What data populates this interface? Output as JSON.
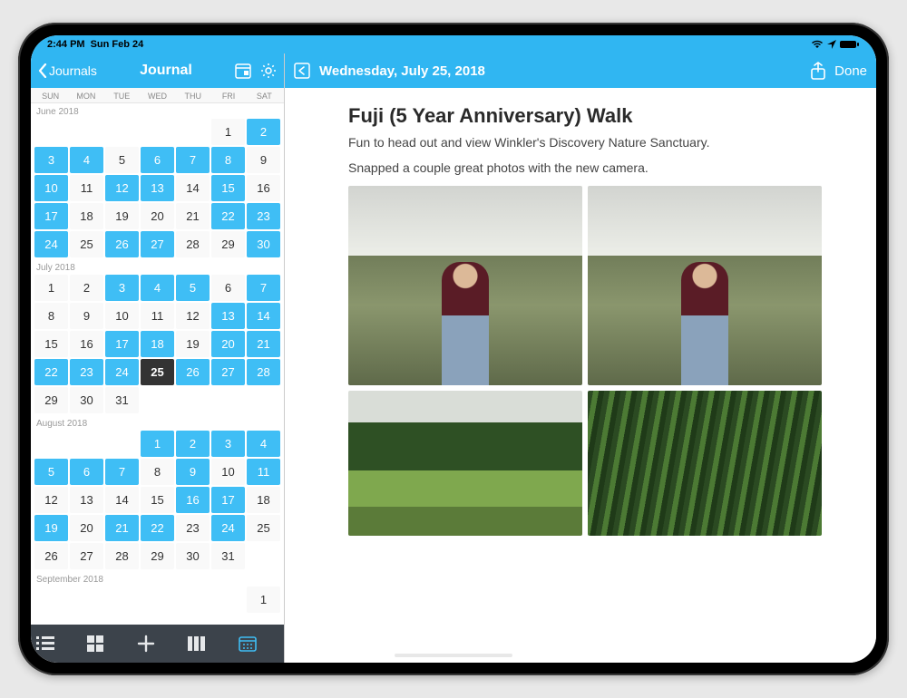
{
  "status": {
    "time": "2:44 PM",
    "date": "Sun Feb 24"
  },
  "left_nav": {
    "back_label": "Journals",
    "title": "Journal"
  },
  "weekdays": [
    "SUN",
    "MON",
    "TUE",
    "WED",
    "THU",
    "FRI",
    "SAT"
  ],
  "months": [
    {
      "label": "June 2018",
      "offset": 5,
      "days": [
        {
          "n": 1
        },
        {
          "n": 2,
          "e": 1
        },
        {
          "n": 3,
          "e": 1
        },
        {
          "n": 4,
          "e": 1
        },
        {
          "n": 5
        },
        {
          "n": 6,
          "e": 1
        },
        {
          "n": 7,
          "e": 1
        },
        {
          "n": 8,
          "e": 1
        },
        {
          "n": 9
        },
        {
          "n": 10,
          "e": 1
        },
        {
          "n": 11
        },
        {
          "n": 12,
          "e": 1
        },
        {
          "n": 13,
          "e": 1
        },
        {
          "n": 14
        },
        {
          "n": 15,
          "e": 1
        },
        {
          "n": 16
        },
        {
          "n": 17,
          "e": 1
        },
        {
          "n": 18
        },
        {
          "n": 19
        },
        {
          "n": 20
        },
        {
          "n": 21
        },
        {
          "n": 22,
          "e": 1
        },
        {
          "n": 23,
          "e": 1
        },
        {
          "n": 24,
          "e": 1
        },
        {
          "n": 25
        },
        {
          "n": 26,
          "e": 1
        },
        {
          "n": 27,
          "e": 1
        },
        {
          "n": 28
        },
        {
          "n": 29
        },
        {
          "n": 30,
          "e": 1
        }
      ]
    },
    {
      "label": "July 2018",
      "offset": 0,
      "days": [
        {
          "n": 1
        },
        {
          "n": 2
        },
        {
          "n": 3,
          "e": 1
        },
        {
          "n": 4,
          "e": 1
        },
        {
          "n": 5,
          "e": 1
        },
        {
          "n": 6
        },
        {
          "n": 7,
          "e": 1
        },
        {
          "n": 8
        },
        {
          "n": 9
        },
        {
          "n": 10
        },
        {
          "n": 11
        },
        {
          "n": 12
        },
        {
          "n": 13,
          "e": 1
        },
        {
          "n": 14,
          "e": 1
        },
        {
          "n": 15
        },
        {
          "n": 16
        },
        {
          "n": 17,
          "e": 1
        },
        {
          "n": 18,
          "e": 1
        },
        {
          "n": 19
        },
        {
          "n": 20,
          "e": 1
        },
        {
          "n": 21,
          "e": 1
        },
        {
          "n": 22,
          "e": 1
        },
        {
          "n": 23,
          "e": 1
        },
        {
          "n": 24,
          "e": 1
        },
        {
          "n": 25,
          "sel": 1
        },
        {
          "n": 26,
          "e": 1
        },
        {
          "n": 27,
          "e": 1
        },
        {
          "n": 28,
          "e": 1
        },
        {
          "n": 29
        },
        {
          "n": 30
        },
        {
          "n": 31
        }
      ]
    },
    {
      "label": "August 2018",
      "offset": 3,
      "days": [
        {
          "n": 1,
          "e": 1
        },
        {
          "n": 2,
          "e": 1
        },
        {
          "n": 3,
          "e": 1
        },
        {
          "n": 4,
          "e": 1
        },
        {
          "n": 5,
          "e": 1
        },
        {
          "n": 6,
          "e": 1
        },
        {
          "n": 7,
          "e": 1
        },
        {
          "n": 8
        },
        {
          "n": 9,
          "e": 1
        },
        {
          "n": 10
        },
        {
          "n": 11,
          "e": 1
        },
        {
          "n": 12
        },
        {
          "n": 13
        },
        {
          "n": 14
        },
        {
          "n": 15
        },
        {
          "n": 16,
          "e": 1
        },
        {
          "n": 17,
          "e": 1
        },
        {
          "n": 18
        },
        {
          "n": 19,
          "e": 1
        },
        {
          "n": 20
        },
        {
          "n": 21,
          "e": 1
        },
        {
          "n": 22,
          "e": 1
        },
        {
          "n": 23
        },
        {
          "n": 24,
          "e": 1
        },
        {
          "n": 25
        },
        {
          "n": 26
        },
        {
          "n": 27
        },
        {
          "n": 28
        },
        {
          "n": 29
        },
        {
          "n": 30
        },
        {
          "n": 31
        }
      ]
    },
    {
      "label": "September 2018",
      "offset": 6,
      "days": [
        {
          "n": 1
        }
      ]
    }
  ],
  "entry": {
    "date_label": "Wednesday, July 25, 2018",
    "done_label": "Done",
    "title": "Fuji (5 Year Anniversary) Walk",
    "paragraphs": [
      "Fun to head out and view Winkler's Discovery Nature Sanctuary.",
      "Snapped a couple great photos with the new camera."
    ]
  }
}
